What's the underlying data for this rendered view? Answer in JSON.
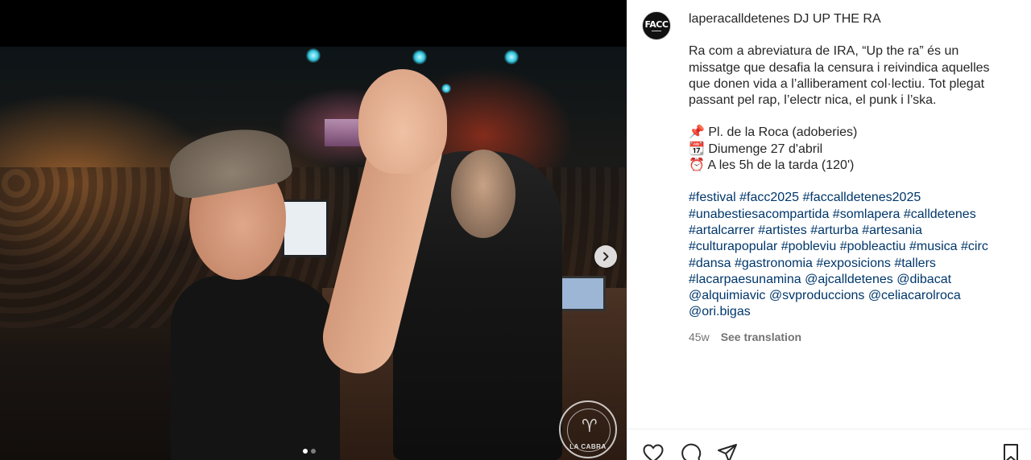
{
  "post": {
    "media": {
      "watermark_text": "LA CABRA",
      "carousel": {
        "count": 2,
        "active_index": 0
      },
      "next_icon": "chevron-right-icon"
    },
    "author": {
      "avatar_text": "FACC",
      "username": "laperacalldetenes"
    },
    "title": "DJ UP THE RA",
    "caption_lines": [
      "Ra com a abreviatura de IRA, “Up the ra” és un missatge que desafia la censura i reivindica aquelles que donen vida a l’alliberament col·lectiu. Tot plegat passant pel rap, l’electr nica, el punk i l’ska."
    ],
    "details": [
      {
        "icon": "📌",
        "text": "Pl. de la Roca (adoberies)"
      },
      {
        "icon": "📆",
        "text": "Diumenge 27 d'abril"
      },
      {
        "icon": "⏰",
        "text": "A les 5h de la tarda (120')"
      }
    ],
    "hashtags": [
      "#festival",
      "#facc2025",
      "#faccalldetenes2025",
      "#unabestiesacompartida",
      "#somlapera",
      "#calldetenes",
      "#artalcarrer",
      "#artistes",
      "#arturba",
      "#artesania",
      "#culturapopular",
      "#pobleviu",
      "#pobleactiu",
      "#musica",
      "#circ",
      "#dansa",
      "#gastronomia",
      "#exposicions",
      "#tallers",
      "#lacarpaesunamina",
      "@ajcalldetenes",
      "@dibacat",
      "@alquimiavic",
      "@svproduccions",
      "@celiacarolroca",
      "@ori.bigas"
    ],
    "time_ago": "45w",
    "see_translation": "See translation",
    "colors": {
      "link": "#00376b",
      "text": "#262626",
      "muted": "#737373"
    },
    "actions": [
      "heart-icon",
      "comment-icon",
      "share-icon",
      "bookmark-icon"
    ]
  }
}
